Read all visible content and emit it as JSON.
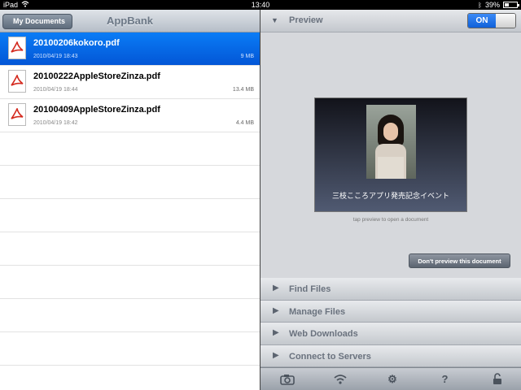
{
  "status_bar": {
    "device": "iPad",
    "time": "13:40",
    "battery": "39%",
    "battery_level": 0.39
  },
  "left_nav": {
    "back_label": "My Documents",
    "title": "AppBank"
  },
  "files": [
    {
      "name": "20100206kokoro.pdf",
      "date": "2010/04/19 18:43",
      "size": "9 MB",
      "selected": true
    },
    {
      "name": "20100222AppleStoreZinza.pdf",
      "date": "2010/04/19 18:44",
      "size": "13.4 MB",
      "selected": false
    },
    {
      "name": "20100409AppleStoreZinza.pdf",
      "date": "2010/04/19 18:42",
      "size": "4.4 MB",
      "selected": false
    }
  ],
  "preview": {
    "section_title": "Preview",
    "toggle_label": "ON",
    "caption": "三枝こころアプリ発売記念イベント",
    "hint": "tap preview to open a document",
    "dont_preview_label": "Don't preview this document"
  },
  "menu": {
    "items": [
      "Find Files",
      "Manage Files",
      "Web Downloads",
      "Connect to Servers"
    ]
  },
  "toolbar": {
    "icons": [
      "camera-icon",
      "wifi-icon",
      "gear-icon",
      "help-icon",
      "lock-icon"
    ]
  },
  "colors": {
    "selection": "#0a6ff0",
    "toggle_on": "#1f73e8"
  }
}
